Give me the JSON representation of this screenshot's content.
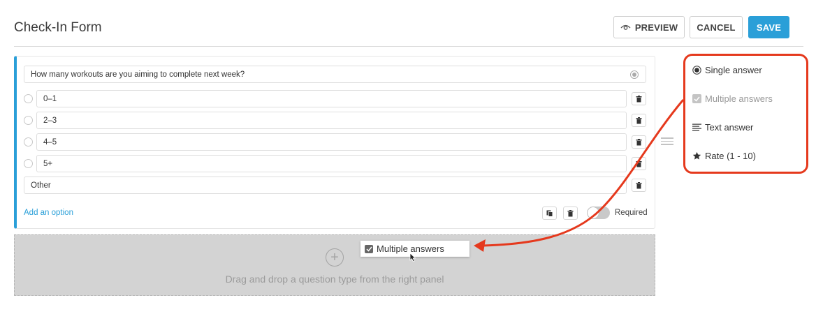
{
  "header": {
    "title": "Check-In Form",
    "preview_label": "PREVIEW",
    "cancel_label": "CANCEL",
    "save_label": "SAVE"
  },
  "question": {
    "text": "How many workouts are you aiming to complete next week?",
    "options": [
      "0–1",
      "2–3",
      "4–5",
      "5+"
    ],
    "other_label": "Other",
    "add_option_label": "Add an option",
    "required_label": "Required",
    "required": false
  },
  "drop_zone": {
    "text": "Drag and drop a question type from the right panel"
  },
  "drag_chip": {
    "label": "Multiple answers"
  },
  "panel": {
    "items": [
      {
        "label": "Single answer",
        "icon": "radio-icon",
        "enabled": true
      },
      {
        "label": "Multiple answers",
        "icon": "checkbox-icon",
        "enabled": false
      },
      {
        "label": "Text answer",
        "icon": "text-lines-icon",
        "enabled": true
      },
      {
        "label": "Rate (1 - 10)",
        "icon": "star-icon",
        "enabled": true
      }
    ]
  },
  "colors": {
    "accent": "#2a9fd8",
    "highlight": "#e5391d"
  }
}
